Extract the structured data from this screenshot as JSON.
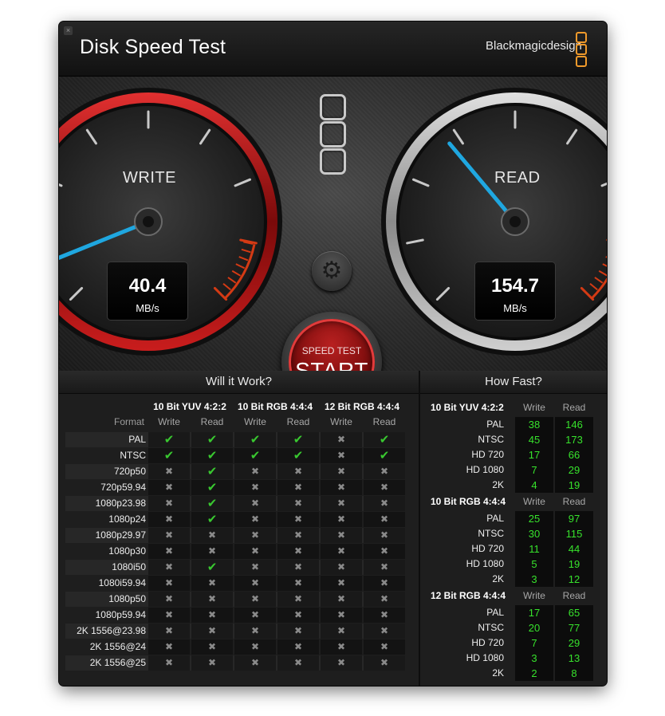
{
  "app": {
    "title": "Disk Speed Test",
    "brand": "Blackmagicdesign",
    "close_glyph": "×",
    "accent": "#f19a2b"
  },
  "gauges": {
    "write": {
      "label": "WRITE",
      "value": "40.4",
      "unit": "MB/s",
      "needle_color": "#1fa7e0",
      "ring_color": "#b31414"
    },
    "read": {
      "label": "READ",
      "value": "154.7",
      "unit": "MB/s",
      "needle_color": "#1fa7e0",
      "ring_color": "#9a9a9a"
    }
  },
  "controls": {
    "settings_icon": "gear-icon",
    "settings_glyph": "⚙",
    "start_sub": "SPEED TEST",
    "start_main": "START"
  },
  "will_it_work": {
    "title": "Will it Work?",
    "format_label": "Format",
    "groups": [
      "10 Bit YUV 4:2:2",
      "10 Bit RGB 4:4:4",
      "12 Bit RGB 4:4:4"
    ],
    "subheads": [
      "Write",
      "Read",
      "Write",
      "Read",
      "Write",
      "Read"
    ],
    "ok_glyph": "✔",
    "no_glyph": "✖",
    "rows": [
      {
        "format": "PAL",
        "cells": [
          1,
          1,
          1,
          1,
          0,
          1
        ]
      },
      {
        "format": "NTSC",
        "cells": [
          1,
          1,
          1,
          1,
          0,
          1
        ]
      },
      {
        "format": "720p50",
        "cells": [
          0,
          1,
          0,
          0,
          0,
          0
        ]
      },
      {
        "format": "720p59.94",
        "cells": [
          0,
          1,
          0,
          0,
          0,
          0
        ]
      },
      {
        "format": "1080p23.98",
        "cells": [
          0,
          1,
          0,
          0,
          0,
          0
        ]
      },
      {
        "format": "1080p24",
        "cells": [
          0,
          1,
          0,
          0,
          0,
          0
        ]
      },
      {
        "format": "1080p29.97",
        "cells": [
          0,
          0,
          0,
          0,
          0,
          0
        ]
      },
      {
        "format": "1080p30",
        "cells": [
          0,
          0,
          0,
          0,
          0,
          0
        ]
      },
      {
        "format": "1080i50",
        "cells": [
          0,
          1,
          0,
          0,
          0,
          0
        ]
      },
      {
        "format": "1080i59.94",
        "cells": [
          0,
          0,
          0,
          0,
          0,
          0
        ]
      },
      {
        "format": "1080p50",
        "cells": [
          0,
          0,
          0,
          0,
          0,
          0
        ]
      },
      {
        "format": "1080p59.94",
        "cells": [
          0,
          0,
          0,
          0,
          0,
          0
        ]
      },
      {
        "format": "2K 1556@23.98",
        "cells": [
          0,
          0,
          0,
          0,
          0,
          0
        ]
      },
      {
        "format": "2K 1556@24",
        "cells": [
          0,
          0,
          0,
          0,
          0,
          0
        ]
      },
      {
        "format": "2K 1556@25",
        "cells": [
          0,
          0,
          0,
          0,
          0,
          0
        ]
      }
    ]
  },
  "how_fast": {
    "title": "How Fast?",
    "write_label": "Write",
    "read_label": "Read",
    "groups": [
      {
        "name": "10 Bit YUV 4:2:2",
        "rows": [
          {
            "format": "PAL",
            "write": "38",
            "read": "146"
          },
          {
            "format": "NTSC",
            "write": "45",
            "read": "173"
          },
          {
            "format": "HD 720",
            "write": "17",
            "read": "66"
          },
          {
            "format": "HD 1080",
            "write": "7",
            "read": "29"
          },
          {
            "format": "2K",
            "write": "4",
            "read": "19"
          }
        ]
      },
      {
        "name": "10 Bit RGB 4:4:4",
        "rows": [
          {
            "format": "PAL",
            "write": "25",
            "read": "97"
          },
          {
            "format": "NTSC",
            "write": "30",
            "read": "115"
          },
          {
            "format": "HD 720",
            "write": "11",
            "read": "44"
          },
          {
            "format": "HD 1080",
            "write": "5",
            "read": "19"
          },
          {
            "format": "2K",
            "write": "3",
            "read": "12"
          }
        ]
      },
      {
        "name": "12 Bit RGB 4:4:4",
        "rows": [
          {
            "format": "PAL",
            "write": "17",
            "read": "65"
          },
          {
            "format": "NTSC",
            "write": "20",
            "read": "77"
          },
          {
            "format": "HD 720",
            "write": "7",
            "read": "29"
          },
          {
            "format": "HD 1080",
            "write": "3",
            "read": "13"
          },
          {
            "format": "2K",
            "write": "2",
            "read": "8"
          }
        ]
      }
    ]
  }
}
